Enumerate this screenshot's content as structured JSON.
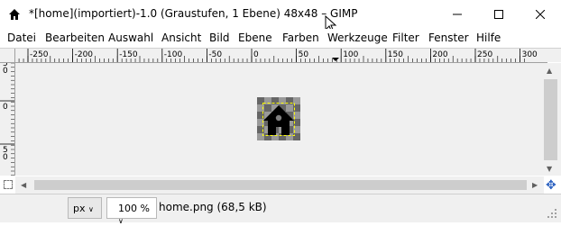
{
  "window": {
    "title": "*[home](importiert)-1.0 (Graustufen, 1 Ebene) 48x48 – GIMP",
    "controls": [
      "minimize",
      "maximize",
      "close"
    ]
  },
  "menu": {
    "items": [
      "Datei",
      "Bearbeiten",
      "Auswahl",
      "Ansicht",
      "Bild",
      "Ebene",
      "Farben",
      "Werkzeuge",
      "Filter",
      "Fenster",
      "Hilfe"
    ]
  },
  "ruler": {
    "horizontal_labels": [
      "-250",
      "-200",
      "-150",
      "-100",
      "-50",
      "0",
      "50",
      "100",
      "150",
      "200",
      "250",
      "300"
    ],
    "vertical_labels": [
      "50",
      "0",
      "50"
    ]
  },
  "canvas": {
    "image_name": "home.png",
    "icon": "house-icon"
  },
  "status": {
    "unit": "px",
    "zoom": "100 %",
    "file_info": "home.png (68,5 kB)"
  }
}
